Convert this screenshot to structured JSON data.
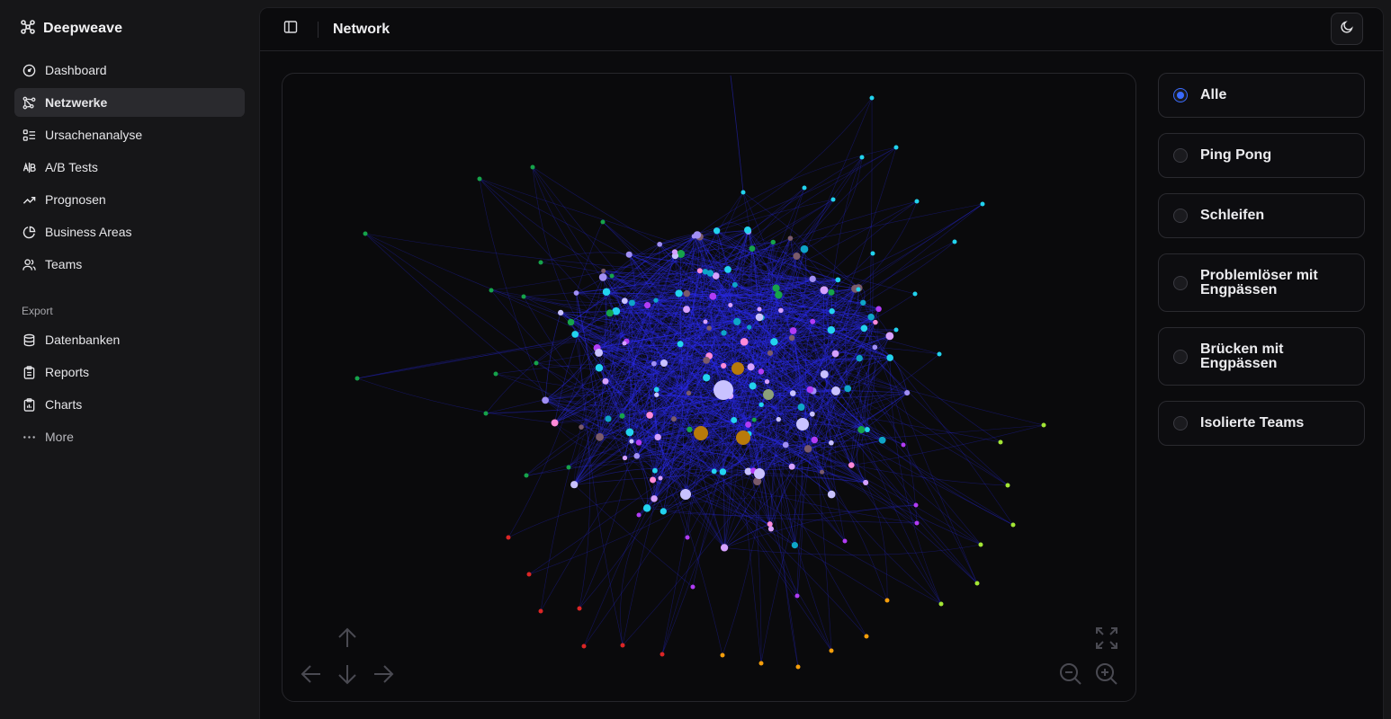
{
  "app": {
    "name": "Deepweave"
  },
  "sidebar": {
    "items": [
      {
        "label": "Dashboard",
        "icon": "gauge-icon"
      },
      {
        "label": "Netzwerke",
        "icon": "network-icon",
        "active": true
      },
      {
        "label": "Ursachenanalyse",
        "icon": "list-checks-icon"
      },
      {
        "label": "A/B Tests",
        "icon": "ab-test-icon"
      },
      {
        "label": "Prognosen",
        "icon": "trending-up-icon"
      },
      {
        "label": "Business Areas",
        "icon": "pie-chart-icon"
      },
      {
        "label": "Teams",
        "icon": "users-icon"
      }
    ],
    "export_label": "Export",
    "export_items": [
      {
        "label": "Datenbanken",
        "icon": "database-icon"
      },
      {
        "label": "Reports",
        "icon": "clipboard-icon"
      },
      {
        "label": "Charts",
        "icon": "clipboard-chart-icon"
      }
    ],
    "more_label": "More"
  },
  "header": {
    "title": "Network"
  },
  "filters": {
    "selected": "Alle",
    "options": [
      {
        "label": "Alle",
        "checked": true
      },
      {
        "label": "Ping Pong",
        "checked": false
      },
      {
        "label": "Schleifen",
        "checked": false
      },
      {
        "label": "Problemlöser mit Engpässen",
        "checked": false
      },
      {
        "label": "Brücken mit Engpässen",
        "checked": false
      },
      {
        "label": "Isolierte Teams",
        "checked": false
      }
    ]
  },
  "graph": {
    "node_colors": [
      "#c9c2ff",
      "#a18ff5",
      "#d6a1ff",
      "#b13cf5",
      "#ff8ad8",
      "#22d3ee",
      "#0ea5c8",
      "#16a34a",
      "#7a5a6a",
      "#b87a0a",
      "#dc2626",
      "#f59e0b",
      "#a3e635",
      "#8ca07a"
    ],
    "edge_color": "#2b2cf0"
  }
}
